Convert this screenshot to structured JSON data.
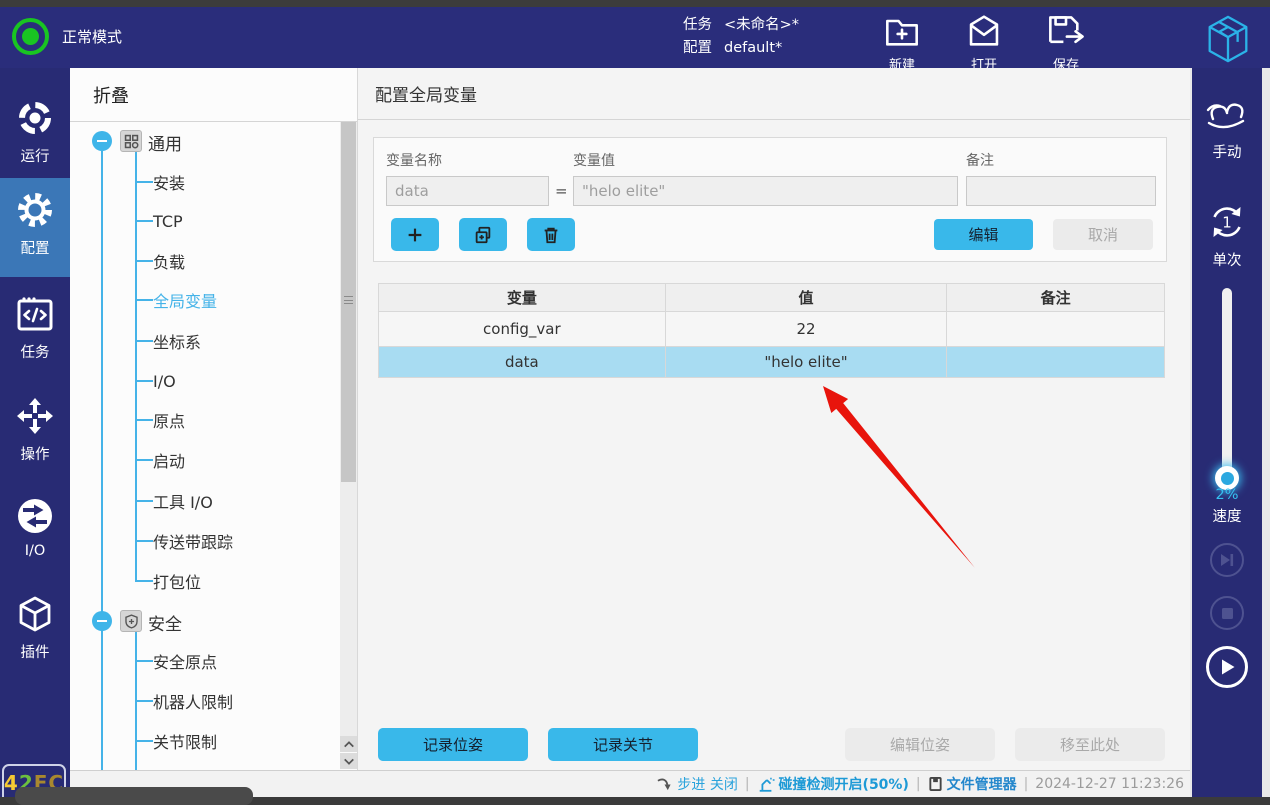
{
  "topbar": {
    "mode_label": "正常模式",
    "task_label": "任务",
    "task_value": "<未命名>*",
    "config_label": "配置",
    "config_value": "default*",
    "actions": [
      {
        "label": "新建"
      },
      {
        "label": "打开"
      },
      {
        "label": "保存"
      }
    ]
  },
  "left_nav": {
    "items": [
      {
        "label": "运行"
      },
      {
        "label": "配置"
      },
      {
        "label": "任务"
      },
      {
        "label": "操作"
      },
      {
        "label": "I/O"
      },
      {
        "label": "插件"
      }
    ],
    "badge": {
      "part1": "4",
      "part2": "2",
      "part3": "FC"
    }
  },
  "tree": {
    "header": "折叠",
    "groups": [
      {
        "label": "通用",
        "children": [
          "安装",
          "TCP",
          "负载",
          "全局变量",
          "坐标系",
          "I/O",
          "原点",
          "启动",
          "工具 I/O",
          "传送带跟踪",
          "打包位"
        ],
        "selected_child": "全局变量"
      },
      {
        "label": "安全",
        "children": [
          "安全原点",
          "机器人限制",
          "关节限制"
        ]
      }
    ]
  },
  "main": {
    "title": "配置全局变量",
    "form": {
      "name_label": "变量名称",
      "name_value": "data",
      "equals": "=",
      "value_label": "变量值",
      "value_value": "\"helo elite\"",
      "note_label": "备注",
      "note_value": "",
      "edit_label": "编辑",
      "cancel_label": "取消"
    },
    "table": {
      "headers": [
        "变量",
        "值",
        "备注"
      ],
      "rows": [
        {
          "name": "config_var",
          "value": "22",
          "note": ""
        },
        {
          "name": "data",
          "value": "\"helo elite\"",
          "note": ""
        }
      ],
      "selected_row": "data"
    },
    "footer_buttons": [
      {
        "label": "记录位姿"
      },
      {
        "label": "记录关节"
      },
      {
        "label": "编辑位姿"
      },
      {
        "label": "移至此处"
      }
    ]
  },
  "right_nav": {
    "manual_label": "手动",
    "single_label": "单次",
    "single_digit": "1",
    "speed_value": "2%",
    "speed_label": "速度"
  },
  "statusbar": {
    "step_label": "步进 关闭",
    "collision_label": "碰撞检测开启(50%)",
    "file_manager_label": "文件管理器",
    "datetime": "2024-12-27 11:23:26"
  },
  "colors": {
    "navy": "#2a2d7b",
    "active_nav": "#3b77b7",
    "accent_cyan": "#39b8ea",
    "selected_row": "#a8dcf2",
    "status_blue": "#1e9ad6",
    "ok_green": "#19c522",
    "arrow_red": "#e8140c"
  }
}
